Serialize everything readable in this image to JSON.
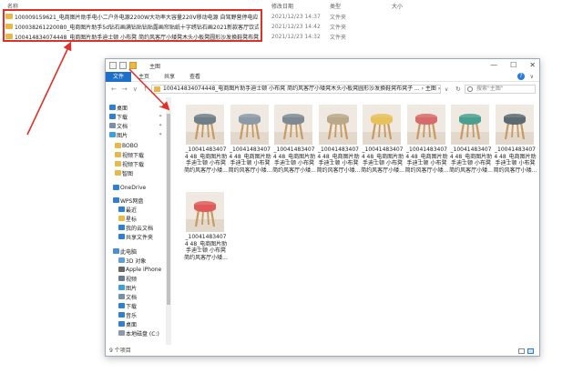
{
  "background_list": {
    "headers": {
      "name": "名称",
      "date": "修改日期",
      "type": "类型",
      "size": "大小"
    },
    "rows": [
      {
        "name": "100009159621_电商图片助手电小二户外电源2200W大功率大容量220V移动电源 自驾野营停电应急备用储能电",
        "date": "2021/12/23 14:37",
        "type": "文件夹"
      },
      {
        "name": "100038261220080_电商图片助手5d钻石画满钻贴钻贴露画帘贴纸十字绣钻石画2021新款客厅饮式三联画 圆钻满钻",
        "date": "2021/12/23 14:42",
        "type": "文件夹"
      },
      {
        "name": "100414834074448_电商图片助手迪士顿 小布凳 简约风客厅小矮凳木头小板凳圆形沙发换鞋凳布凳子 颜色、图",
        "date": "2021/12/23 14:32",
        "type": "文件夹"
      }
    ]
  },
  "window": {
    "title": "主图",
    "controls": {
      "minimize": "—",
      "maximize": "☐",
      "close": "✕"
    },
    "ribbon_tabs": [
      "文件",
      "主页",
      "共享",
      "查看"
    ],
    "ribbon_right": "∨",
    "help": "?",
    "nav": {
      "back": "←",
      "forward": "→",
      "up_list": "∨",
      "up": "↑"
    },
    "address": "100414834074448_电商图片助手迪士顿 小布凳 简约风客厅小矮凳木头小板凳圆形沙发换鞋凳布凳子 ... › 主图 ›",
    "address_drop": "∨",
    "refresh": "↻",
    "search_placeholder": "搜索\"主图\"",
    "sidebar": [
      {
        "label": "桌面",
        "pin": true,
        "color": "#2f7fd6"
      },
      {
        "label": "下载",
        "pin": true,
        "color": "#2f7fd6"
      },
      {
        "label": "文档",
        "pin": true,
        "color": "#7a8ea6"
      },
      {
        "label": "图片",
        "pin": true,
        "color": "#3f9fd8"
      },
      {
        "label": "BOBO",
        "pin": false,
        "color": "#e8b84a"
      },
      {
        "label": "视频下载",
        "pin": false,
        "color": "#e8b84a"
      },
      {
        "label": "视频下载",
        "pin": false,
        "color": "#e8b84a"
      },
      {
        "label": "智图",
        "pin": false,
        "color": "#e8b84a"
      },
      {
        "label": "OneDrive",
        "pin": false,
        "color": "#2f7fd6"
      },
      {
        "label": "WPS网盘",
        "pin": false,
        "color": "#2f7fd6"
      },
      {
        "label": "最近",
        "pin": false,
        "color": "#2f7fd6"
      },
      {
        "label": "星标",
        "pin": false,
        "color": "#e8b84a"
      },
      {
        "label": "我的云文档",
        "pin": false,
        "color": "#2f7fd6"
      },
      {
        "label": "共享文件夹",
        "pin": false,
        "color": "#2f7fd6"
      },
      {
        "label": "此电脑",
        "pin": false,
        "color": "#4a8ed8"
      },
      {
        "label": "3D 对象",
        "pin": false,
        "color": "#5aa0e0"
      },
      {
        "label": "Apple iPhone",
        "pin": false,
        "color": "#666666"
      },
      {
        "label": "视频",
        "pin": false,
        "color": "#6a7a90"
      },
      {
        "label": "图片",
        "pin": false,
        "color": "#3f9fd8"
      },
      {
        "label": "文档",
        "pin": false,
        "color": "#7a8ea6"
      },
      {
        "label": "下载",
        "pin": false,
        "color": "#2f7fd6"
      },
      {
        "label": "音乐",
        "pin": false,
        "color": "#2f7fd6"
      },
      {
        "label": "桌面",
        "pin": false,
        "color": "#2f7fd6"
      },
      {
        "label": "本地磁盘 (C:)",
        "pin": false,
        "color": "#8a9aaa"
      }
    ],
    "files": [
      {
        "label": "_100414834074 48_电商图片助手迪士顿 小布凳 简约风客厅小矮...",
        "seat": "#6f7f88",
        "legs": "#c79a62"
      },
      {
        "label": "_100414834074 48_电商图片助手迪士顿 小布凳 简约风客厅小矮...",
        "seat": "#8a9aa6",
        "legs": "#c79a62"
      },
      {
        "label": "_100414834074 48_电商图片助手迪士顿 小布凳 简约风客厅小矮...",
        "seat": "#7d8a94",
        "legs": "#c79a62"
      },
      {
        "label": "_100414834074 48_电商图片助手迪士顿 小布凳 简约风客厅小矮...",
        "seat": "#b9a98a",
        "legs": "#c79a62"
      },
      {
        "label": "_100414834074 48_电商图片助手迪士顿 小布凳 简约风客厅小矮...",
        "seat": "#e6c25a",
        "legs": "#c79a62"
      },
      {
        "label": "_100414834074 48_电商图片助手迪士顿 小布凳 简约风客厅小矮...",
        "seat": "#d76a6a",
        "legs": "#c79a62"
      },
      {
        "label": "_100414834074 48_电商图片助手迪士顿 小布凳 简约风客厅小矮...",
        "seat": "#4aa090",
        "legs": "#c79a62"
      },
      {
        "label": "_100414834074 48_电商图片助手迪士顿 小布凳 简约风客厅小矮...",
        "seat": "#5a6a70",
        "legs": "#c79a62"
      },
      {
        "label": "_100414834074 48_电商图片助手迪士顿 小布凳 简约风客厅小矮...",
        "seat": "#e05a5a",
        "legs": "#c79a62"
      }
    ],
    "status": "9 个项目"
  },
  "colors": {
    "highlight": "#e0302a",
    "accent": "#1e6fc8"
  }
}
